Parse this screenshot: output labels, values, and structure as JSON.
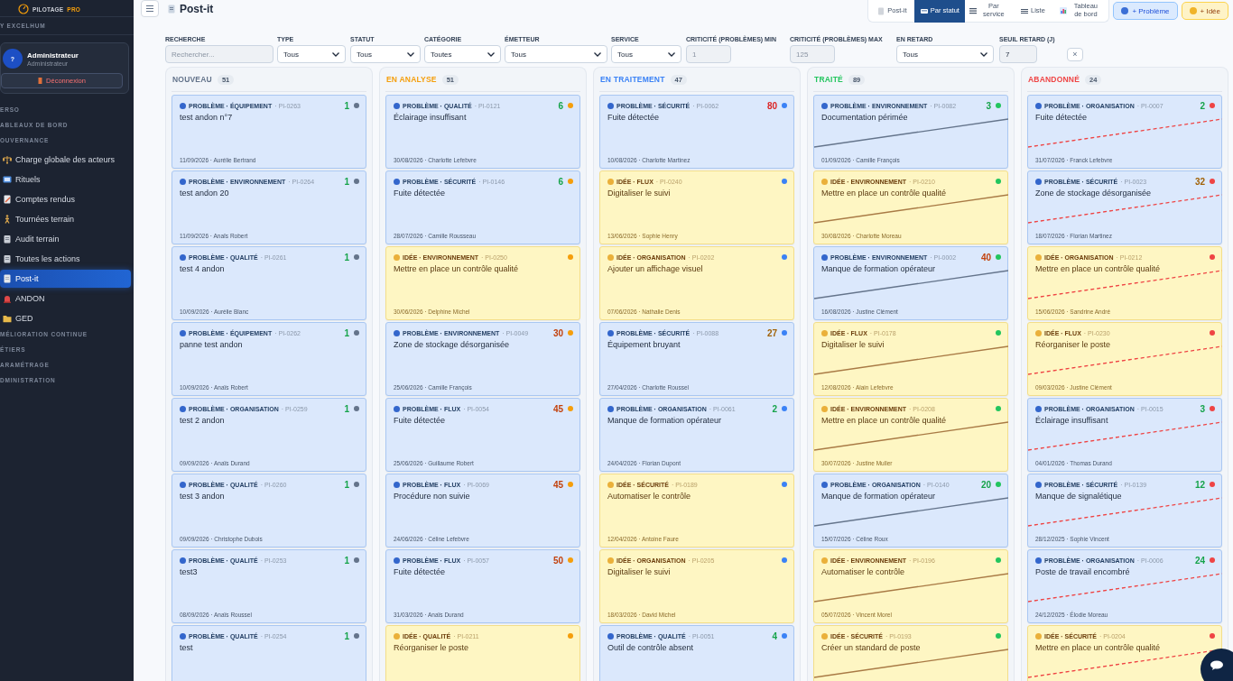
{
  "sidebar": {
    "logo": "PILOTAGE",
    "logo_accent": "PRO",
    "org": "Y EXCELHUM",
    "user": {
      "avatar": "?",
      "name": "Administrateur",
      "role": "Administrateur",
      "logout": "Déconnexion"
    },
    "sections": [
      {
        "label": "ERSO"
      },
      {
        "label": "ABLEAUX DE BORD"
      },
      {
        "label": "OUVERNANCE",
        "items": [
          {
            "label": "Charge globale des acteurs",
            "selected": false
          },
          {
            "label": "Rituels",
            "selected": false
          },
          {
            "label": "Comptes rendus",
            "selected": false
          },
          {
            "label": "Tournées terrain",
            "selected": false
          },
          {
            "label": "Audit terrain",
            "selected": false
          },
          {
            "label": "Toutes les actions",
            "selected": false
          },
          {
            "label": "Post-it",
            "selected": true
          },
          {
            "label": "ANDON",
            "selected": false
          },
          {
            "label": "GED",
            "selected": false
          }
        ]
      },
      {
        "label": "MÉLIORATION CONTINUE"
      },
      {
        "label": "ÉTIERS"
      },
      {
        "label": "ARAMÉTRAGE"
      },
      {
        "label": "DMINISTRATION"
      }
    ]
  },
  "header": {
    "title": "Post-it",
    "views": [
      {
        "label": "Post-it",
        "selected": false
      },
      {
        "label": "Par statut",
        "selected": true
      },
      {
        "label": "Par service",
        "selected": false
      },
      {
        "label": "Liste",
        "selected": false
      },
      {
        "label": "Tableau de bord",
        "selected": false
      }
    ],
    "actions": [
      {
        "kind": "probleme",
        "label": "+ Problème"
      },
      {
        "kind": "idee",
        "label": "+ Idée"
      }
    ]
  },
  "filters": [
    {
      "kind": "search",
      "label": "RECHERCHE",
      "placeholder": "Rechercher..."
    },
    {
      "kind": "select",
      "label": "TYPE",
      "value": "Tous"
    },
    {
      "kind": "select",
      "label": "STATUT",
      "value": "Tous"
    },
    {
      "kind": "select",
      "label": "CATÉGORIE",
      "value": "Toutes"
    },
    {
      "kind": "select",
      "label": "ÉMETTEUR",
      "value": "Tous"
    },
    {
      "kind": "select",
      "label": "SERVICE",
      "value": "Tous"
    },
    {
      "kind": "number",
      "label": "CRITICITÉ (PROBLÈMES) MIN",
      "placeholder": "1"
    },
    {
      "kind": "number",
      "label": "CRITICITÉ (PROBLÈMES) MAX",
      "placeholder": "125"
    },
    {
      "kind": "select",
      "label": "EN RETARD",
      "value": "Tous"
    },
    {
      "kind": "number",
      "label": "SEUIL RETARD (J)",
      "value": "7"
    }
  ],
  "clear": "×",
  "columns": [
    {
      "title": "NOUVEAU",
      "count": "51",
      "color": "#64748b",
      "done": false,
      "abandoned": false,
      "cards": [
        {
          "kind": "probleme",
          "category": "PROBLÈME · ÉQUIPEMENT",
          "ref": "· PI-0263",
          "title": "test andon n°7",
          "meta": "11/09/2026 · Aurélie Bertrand",
          "age": "1",
          "color": "#16a34a"
        },
        {
          "kind": "probleme",
          "category": "PROBLÈME · ENVIRONNEMENT",
          "ref": "· PI-0264",
          "title": "test andon 20",
          "meta": "11/09/2026 · Anaïs Robert",
          "age": "1",
          "color": "#16a34a"
        },
        {
          "kind": "probleme",
          "category": "PROBLÈME · QUALITÉ",
          "ref": "· PI-0261",
          "title": "test 4 andon",
          "meta": "10/09/2026 · Aurélie Blanc",
          "age": "1",
          "color": "#16a34a"
        },
        {
          "kind": "probleme",
          "category": "PROBLÈME · ÉQUIPEMENT",
          "ref": "· PI-0262",
          "title": "panne test andon",
          "meta": "10/09/2026 · Anaïs Robert",
          "age": "1",
          "color": "#16a34a"
        },
        {
          "kind": "probleme",
          "category": "PROBLÈME · ORGANISATION",
          "ref": "· PI-0259",
          "title": "test 2 andon",
          "meta": "09/09/2026 · Anaïs Durand",
          "age": "1",
          "color": "#16a34a"
        },
        {
          "kind": "probleme",
          "category": "PROBLÈME · QUALITÉ",
          "ref": "· PI-0260",
          "title": "test 3 andon",
          "meta": "09/09/2026 · Christophe Dubois",
          "age": "1",
          "color": "#16a34a"
        },
        {
          "kind": "probleme",
          "category": "PROBLÈME · QUALITÉ",
          "ref": "· PI-0253",
          "title": "test3",
          "meta": "08/09/2026 · Anaïs Roussel",
          "age": "1",
          "color": "#16a34a"
        },
        {
          "kind": "probleme",
          "category": "PROBLÈME · QUALITÉ",
          "ref": "· PI-0254",
          "title": "test",
          "age": "1",
          "color": "#16a34a"
        }
      ]
    },
    {
      "title": "EN ANALYSE",
      "count": "51",
      "color": "#f59e0b",
      "done": false,
      "abandoned": false,
      "cards": [
        {
          "kind": "probleme",
          "category": "PROBLÈME · QUALITÉ",
          "ref": "· PI-0121",
          "title": "Éclairage insuffisant",
          "meta": "30/08/2026 · Charlotte Lefebvre",
          "age": "6",
          "color": "#16a34a"
        },
        {
          "kind": "probleme",
          "category": "PROBLÈME · SÉCURITÉ",
          "ref": "· PI-0146",
          "title": "Fuite détectée",
          "meta": "28/07/2026 · Camille Rousseau",
          "age": "6",
          "color": "#16a34a"
        },
        {
          "kind": "idee",
          "category": "IDÉE · ENVIRONNEMENT",
          "ref": "· PI-0250",
          "title": "Mettre en place un contrôle qualité",
          "meta": "30/06/2026 · Delphine Michel"
        },
        {
          "kind": "probleme",
          "category": "PROBLÈME · ENVIRONNEMENT",
          "ref": "· PI-0049",
          "title": "Zone de stockage désorganisée",
          "meta": "25/06/2026 · Camille François",
          "age": "30",
          "color": "#c2410c"
        },
        {
          "kind": "probleme",
          "category": "PROBLÈME · FLUX",
          "ref": "· PI-0054",
          "title": "Fuite détectée",
          "meta": "25/06/2026 · Guillaume Robert",
          "age": "45",
          "color": "#c2410c"
        },
        {
          "kind": "probleme",
          "category": "PROBLÈME · FLUX",
          "ref": "· PI-0069",
          "title": "Procédure non suivie",
          "meta": "24/06/2026 · Céline Lefebvre",
          "age": "45",
          "color": "#c2410c"
        },
        {
          "kind": "probleme",
          "category": "PROBLÈME · FLUX",
          "ref": "· PI-0057",
          "title": "Fuite détectée",
          "meta": "31/03/2026 · Anaïs Durand",
          "age": "50",
          "color": "#c2410c"
        },
        {
          "kind": "idee",
          "category": "IDÉE · QUALITÉ",
          "ref": "· PI-0211",
          "title": "Réorganiser le poste"
        }
      ]
    },
    {
      "title": "EN TRAITEMENT",
      "count": "47",
      "color": "#3b82f6",
      "done": false,
      "abandoned": false,
      "cards": [
        {
          "kind": "probleme",
          "category": "PROBLÈME · SÉCURITÉ",
          "ref": "· PI-0062",
          "title": "Fuite détectée",
          "meta": "10/08/2026 · Charlotte Martinez",
          "age": "80",
          "color": "#dc2626"
        },
        {
          "kind": "idee",
          "category": "IDÉE · FLUX",
          "ref": "· PI-0240",
          "title": "Digitaliser le suivi",
          "meta": "13/06/2026 · Sophie Henry"
        },
        {
          "kind": "idee",
          "category": "IDÉE · ORGANISATION",
          "ref": "· PI-0202",
          "title": "Ajouter un affichage visuel",
          "meta": "07/06/2026 · Nathalie Denis"
        },
        {
          "kind": "probleme",
          "category": "PROBLÈME · SÉCURITÉ",
          "ref": "· PI-0088",
          "title": "Équipement bruyant",
          "meta": "27/04/2026 · Charlotte Roussel",
          "age": "27",
          "color": "#a16207"
        },
        {
          "kind": "probleme",
          "category": "PROBLÈME · ORGANISATION",
          "ref": "· PI-0061",
          "title": "Manque de formation opérateur",
          "meta": "24/04/2026 · Florian Dupont",
          "age": "2",
          "color": "#16a34a"
        },
        {
          "kind": "idee",
          "category": "IDÉE · SÉCURITÉ",
          "ref": "· PI-0189",
          "title": "Automatiser le contrôle",
          "meta": "12/04/2026 · Antoine Faure"
        },
        {
          "kind": "idee",
          "category": "IDÉE · ORGANISATION",
          "ref": "· PI-0205",
          "title": "Digitaliser le suivi",
          "meta": "18/03/2026 · David Michel"
        },
        {
          "kind": "probleme",
          "category": "PROBLÈME · QUALITÉ",
          "ref": "· PI-0051",
          "title": "Outil de contrôle absent",
          "age": "4",
          "color": "#16a34a"
        }
      ]
    },
    {
      "title": "TRAITÉ",
      "count": "89",
      "color": "#22c55e",
      "done": true,
      "abandoned": false,
      "cards": [
        {
          "kind": "probleme",
          "category": "PROBLÈME · ENVIRONNEMENT",
          "ref": "· PI-0082",
          "title": "Documentation périmée",
          "meta": "01/09/2026 · Camille François",
          "age": "3",
          "color": "#16a34a"
        },
        {
          "kind": "idee",
          "category": "IDÉE · ENVIRONNEMENT",
          "ref": "· PI-0210",
          "title": "Mettre en place un contrôle qualité",
          "meta": "30/08/2026 · Charlotte Moreau"
        },
        {
          "kind": "probleme",
          "category": "PROBLÈME · ENVIRONNEMENT",
          "ref": "· PI-0002",
          "title": "Manque de formation opérateur",
          "meta": "16/08/2026 · Justine Clément",
          "age": "40",
          "color": "#c2410c"
        },
        {
          "kind": "idee",
          "category": "IDÉE · FLUX",
          "ref": "· PI-0178",
          "title": "Digitaliser le suivi",
          "meta": "12/08/2026 · Alain Lefebvre"
        },
        {
          "kind": "idee",
          "category": "IDÉE · ENVIRONNEMENT",
          "ref": "· PI-0208",
          "title": "Mettre en place un contrôle qualité",
          "meta": "30/07/2026 · Justine Muller"
        },
        {
          "kind": "probleme",
          "category": "PROBLÈME · ORGANISATION",
          "ref": "· PI-0140",
          "title": "Manque de formation opérateur",
          "meta": "15/07/2026 · Céline Roux",
          "age": "20",
          "color": "#16a34a"
        },
        {
          "kind": "idee",
          "category": "IDÉE · ENVIRONNEMENT",
          "ref": "· PI-0196",
          "title": "Automatiser le contrôle",
          "meta": "05/07/2026 · Vincent Morel"
        },
        {
          "kind": "idee",
          "category": "IDÉE · SÉCURITÉ",
          "ref": "· PI-0193",
          "title": "Créer un standard de poste"
        }
      ]
    },
    {
      "title": "ABANDONNÉ",
      "count": "24",
      "color": "#ef4444",
      "done": false,
      "abandoned": true,
      "cards": [
        {
          "kind": "probleme",
          "category": "PROBLÈME · ORGANISATION",
          "ref": "· PI-0007",
          "title": "Fuite détectée",
          "meta": "31/07/2026 · Franck Lefebvre",
          "age": "2",
          "color": "#16a34a"
        },
        {
          "kind": "probleme",
          "category": "PROBLÈME · SÉCURITÉ",
          "ref": "· PI-0023",
          "title": "Zone de stockage désorganisée",
          "meta": "18/07/2026 · Florian Martinez",
          "age": "32",
          "color": "#a16207"
        },
        {
          "kind": "idee",
          "category": "IDÉE · ORGANISATION",
          "ref": "· PI-0212",
          "title": "Mettre en place un contrôle qualité",
          "meta": "15/06/2026 · Sandrine André"
        },
        {
          "kind": "idee",
          "category": "IDÉE · FLUX",
          "ref": "· PI-0230",
          "title": "Réorganiser le poste",
          "meta": "09/03/2026 · Justine Clément"
        },
        {
          "kind": "probleme",
          "category": "PROBLÈME · ORGANISATION",
          "ref": "· PI-0015",
          "title": "Éclairage insuffisant",
          "meta": "04/01/2026 · Thomas Durand",
          "age": "3",
          "color": "#16a34a"
        },
        {
          "kind": "probleme",
          "category": "PROBLÈME · SÉCURITÉ",
          "ref": "· PI-0139",
          "title": "Manque de signalétique",
          "meta": "28/12/2025 · Sophie Vincent",
          "age": "12",
          "color": "#16a34a"
        },
        {
          "kind": "probleme",
          "category": "PROBLÈME · ORGANISATION",
          "ref": "· PI-0006",
          "title": "Poste de travail encombré",
          "meta": "24/12/2025 · Élodie Moreau",
          "age": "24",
          "color": "#16a34a"
        },
        {
          "kind": "idee",
          "category": "IDÉE · SÉCURITÉ",
          "ref": "· PI-0204",
          "title": "Mettre en place un contrôle qualité"
        }
      ]
    }
  ]
}
